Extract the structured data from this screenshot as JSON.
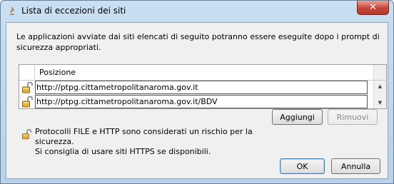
{
  "window": {
    "title": "Lista di eccezioni dei siti",
    "close_glyph": "✕"
  },
  "description": "Le applicazioni avviate dai siti elencati di seguito potranno essere eseguite dopo i prompt di sicurezza appropriati.",
  "table": {
    "column_header": "Posizione",
    "rows": [
      {
        "location": "http://ptpg.cittametropolitanaroma.gov.it"
      },
      {
        "location": "http://ptpg.cittametropolitanaroma.gov.it/BDV"
      }
    ]
  },
  "buttons": {
    "add": "Aggiungi",
    "remove": "Rimuovi",
    "ok": "OK",
    "cancel": "Annulla"
  },
  "warning": {
    "line1": "Protocolli FILE e HTTP sono considerati un rischio per la sicurezza.",
    "line2": "Si consiglia di usare siti HTTPS se disponibili."
  },
  "icons": {
    "title": "java-icon",
    "row": "unlocked-padlock-icon",
    "scroll_up": "▲",
    "scroll_down": "▼"
  },
  "colors": {
    "frame": "#b8d2ea",
    "close": "#c7463a",
    "client": "#f0f0f0"
  }
}
